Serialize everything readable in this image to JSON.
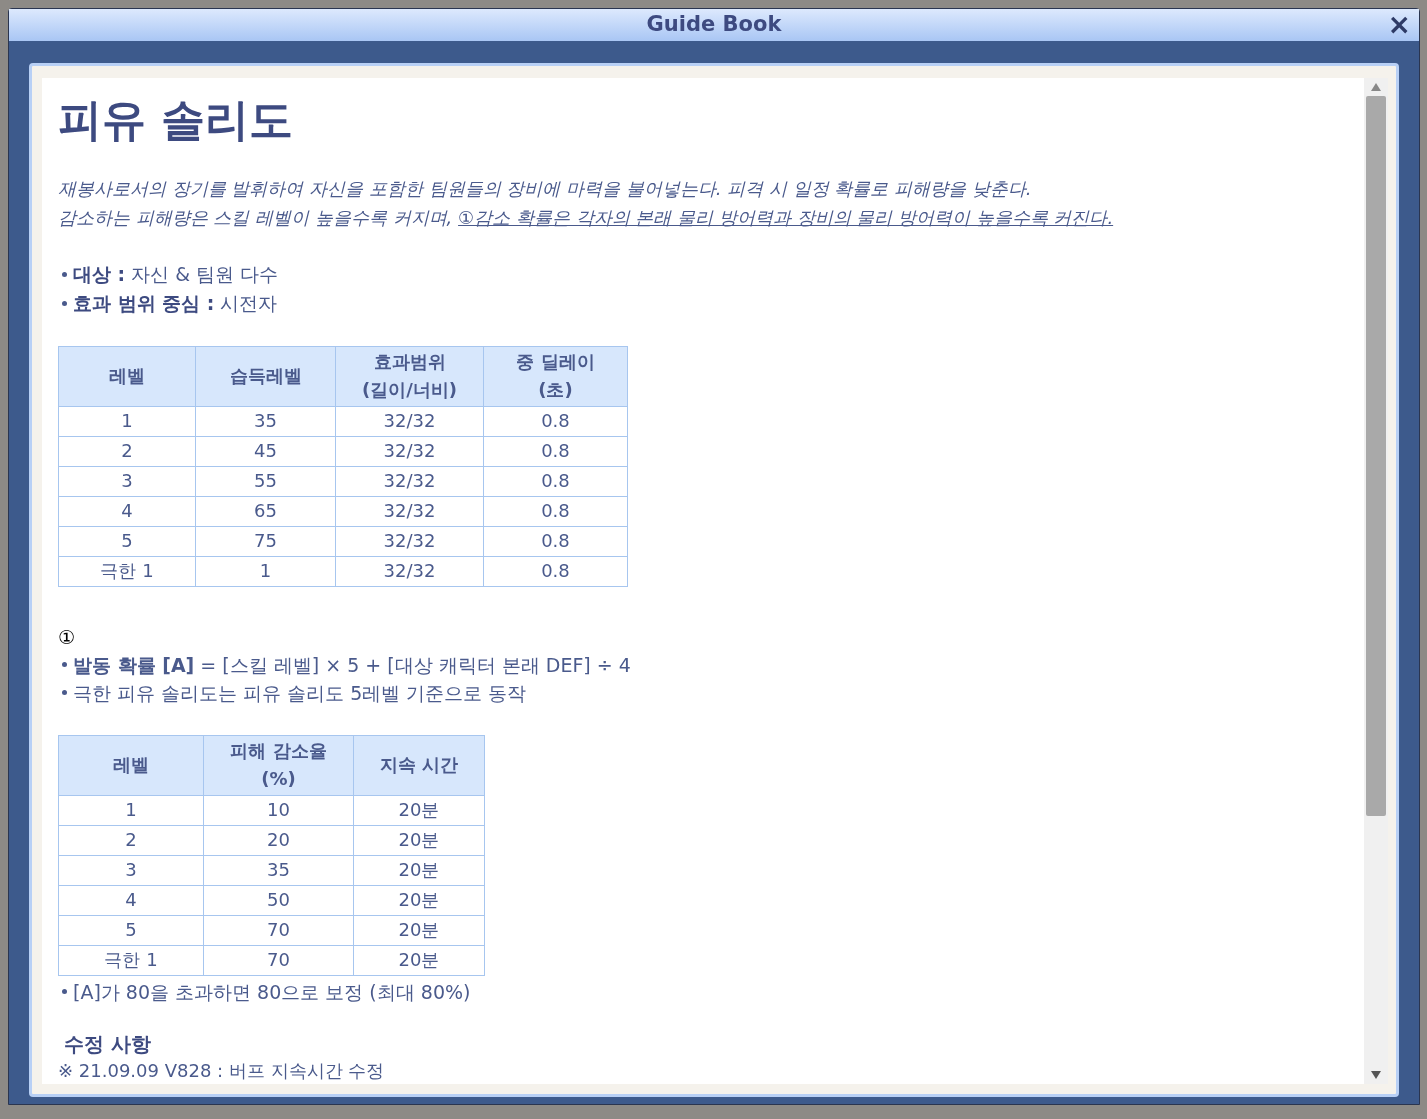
{
  "window": {
    "title": "Guide Book",
    "close": "×"
  },
  "heading": "피유 솔리도",
  "description": [
    {
      "text": "재봉사로서의 장기를 발휘하여 자신을 포함한 팀원들의 장비에 마력을 불어넣는다. 피격 시 일정 확률로 피해량을 낮춘다."
    },
    {
      "text": "감소하는 피해량은 스킬 레벨이 높을수록 커지며, ",
      "link": "①감소 확률은 각자의 본래 물리 방어력과 장비의 물리 방어력이 높을수록 커진다."
    }
  ],
  "facts": [
    {
      "label": "대상 :",
      "value": "자신 & 팀원 다수"
    },
    {
      "label": "효과 범위 중심 :",
      "value": "시전자"
    }
  ],
  "table1": {
    "columns": [
      "레벨",
      "습득레벨",
      "효과범위\n(길이/너비)",
      "중 딜레이\n(초)"
    ],
    "rows": [
      [
        "1",
        "35",
        "32/32",
        "0.8"
      ],
      [
        "2",
        "45",
        "32/32",
        "0.8"
      ],
      [
        "3",
        "55",
        "32/32",
        "0.8"
      ],
      [
        "4",
        "65",
        "32/32",
        "0.8"
      ],
      [
        "5",
        "75",
        "32/32",
        "0.8"
      ],
      [
        "극한 1",
        "1",
        "32/32",
        "0.8"
      ]
    ]
  },
  "note_mark": "①",
  "notes": [
    {
      "text": "**발동 확률 [A]** = [스킬 레벨] × 5 + [대상 캐릭터 본래 DEF] ÷ 4"
    },
    {
      "text": "극한 피유 솔리도는 피유 솔리도 5레벨 기준으로 동작"
    }
  ],
  "table2": {
    "columns": [
      "레벨",
      "피해 감소율\n(%)",
      "지속 시간"
    ],
    "rows": [
      [
        "1",
        "10",
        "20분"
      ],
      [
        "2",
        "20",
        "20분"
      ],
      [
        "3",
        "35",
        "20분"
      ],
      [
        "4",
        "50",
        "20분"
      ],
      [
        "5",
        "70",
        "20분"
      ],
      [
        "극한 1",
        "70",
        "20분"
      ]
    ]
  },
  "table2_note": "[A]가 80을 초과하면 80으로 보정 (최대 80%)",
  "changes": {
    "title": "수정 사항",
    "items": [
      "※ 21.09.09 V828 : 버프 지속시간 수정"
    ]
  }
}
